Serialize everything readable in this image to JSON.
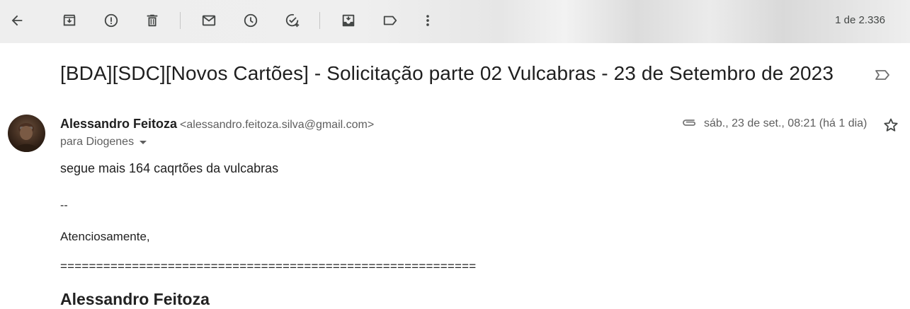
{
  "toolbar": {
    "pager": "1 de 2.336",
    "buttons": [
      {
        "name": "back-arrow-icon"
      },
      {
        "name": "archive-icon"
      },
      {
        "name": "report-spam-icon"
      },
      {
        "name": "delete-icon"
      },
      {
        "name": "mark-unread-icon"
      },
      {
        "name": "snooze-icon"
      },
      {
        "name": "add-to-tasks-icon"
      },
      {
        "name": "move-to-icon"
      },
      {
        "name": "label-icon"
      },
      {
        "name": "more-vert-icon"
      }
    ]
  },
  "email": {
    "subject": "[BDA][SDC][Novos Cartões] - Solicitação parte 02 Vulcabras - 23 de Setembro de 2023",
    "sender_name": "Alessandro Feitoza",
    "sender_email": "<alessandro.feitoza.silva@gmail.com>",
    "recipient": "para Diogenes",
    "date": "sáb., 23 de set., 08:21 (há 1 dia)",
    "body": {
      "line1": "segue mais 164 caqrtões da vulcabras",
      "line2": "--",
      "line3": "Atenciosamente,",
      "line4": "==========================================================",
      "line5": "Alessandro Feitoza"
    }
  },
  "colors": {
    "icon": "#444746",
    "text_primary": "#1f1f1f",
    "text_secondary": "#5e5e5e"
  }
}
